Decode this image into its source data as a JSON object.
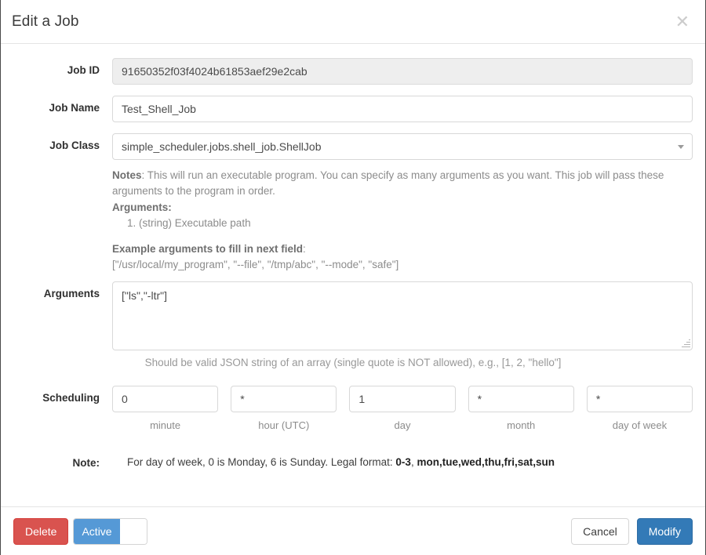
{
  "dialog": {
    "title": "Edit a Job",
    "close_icon": "close-icon"
  },
  "fields": {
    "job_id": {
      "label": "Job ID",
      "value": "91650352f03f4024b61853aef29e2cab"
    },
    "job_name": {
      "label": "Job Name",
      "value": "Test_Shell_Job",
      "placeholder": "Job Name"
    },
    "job_class": {
      "label": "Job Class",
      "value": "simple_scheduler.jobs.shell_job.ShellJob",
      "caret_icon": "chevron-down-icon"
    },
    "arguments": {
      "label": "Arguments",
      "value": "[\"ls\",\"-ltr\"]",
      "help": "Should be valid JSON string of an array (single quote is NOT allowed), e.g., [1, 2, \"hello\"]"
    }
  },
  "notes": {
    "notes_label": "Notes",
    "notes_text": ": This will run an executable program. You can specify as many arguments as you want. This job will pass these arguments to the program in order.",
    "arguments_label": "Arguments:",
    "argument_items": [
      "(string) Executable path"
    ],
    "example_label": "Example arguments to fill in next field",
    "example_colon": ":",
    "example_value": "[\"/usr/local/my_program\", \"--file\", \"/tmp/abc\", \"--mode\", \"safe\"]"
  },
  "scheduling": {
    "label": "Scheduling",
    "cells": [
      {
        "value": "0",
        "caption": "minute"
      },
      {
        "value": "*",
        "caption": "hour (UTC)"
      },
      {
        "value": "1",
        "caption": "day"
      },
      {
        "value": "*",
        "caption": "month"
      },
      {
        "value": "*",
        "caption": "day of week"
      }
    ]
  },
  "note": {
    "label": "Note:",
    "text_before": "For day of week, 0 is Monday, 6 is Sunday. Legal format: ",
    "bold_1": "0-3",
    "separator": ", ",
    "bold_2": "mon,tue,wed,thu,fri,sat,sun"
  },
  "footer": {
    "delete_label": "Delete",
    "toggle_label": "Active",
    "cancel_label": "Cancel",
    "modify_label": "Modify"
  },
  "colors": {
    "danger": "#d9534f",
    "primary": "#337ab7",
    "toggle_on": "#5599d6"
  }
}
